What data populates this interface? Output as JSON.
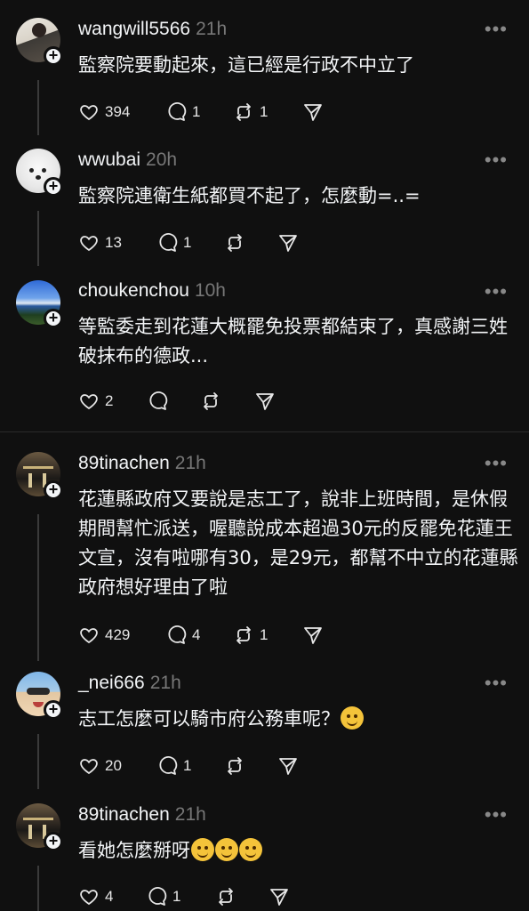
{
  "posts": [
    {
      "username": "wangwill5566",
      "time": "21h",
      "text": "監察院要動起來，這已經是行政不中立了",
      "likes": "394",
      "comments": "1",
      "reposts": "1"
    },
    {
      "username": "wwubai",
      "time": "20h",
      "text": "監察院連衛生紙都買不起了，怎麼動=..=",
      "likes": "13",
      "comments": "1",
      "reposts": ""
    },
    {
      "username": "choukenchou",
      "time": "10h",
      "text": "等監委走到花蓮大概罷免投票都結束了，真感謝三姓破抹布的德政...",
      "likes": "2",
      "comments": "",
      "reposts": ""
    },
    {
      "username": "89tinachen",
      "time": "21h",
      "text": "花蓮縣政府又要說是志工了，說非上班時間，是休假期間幫忙派送，喔聽說成本超過30元的反罷免花蓮王文宣，沒有啦哪有30，是29元，都幫不中立的花蓮縣政府想好理由了啦",
      "likes": "429",
      "comments": "4",
      "reposts": "1"
    },
    {
      "username": "_nei666",
      "time": "21h",
      "text": "志工怎麼可以騎市府公務車呢？",
      "likes": "20",
      "comments": "1",
      "reposts": ""
    },
    {
      "username": "89tinachen",
      "time": "21h",
      "text": "看她怎麼掰呀",
      "likes": "4",
      "comments": "1",
      "reposts": ""
    }
  ],
  "more_label": "•••",
  "icons": {
    "like": "heart-icon",
    "comment": "comment-bubble-icon",
    "repost": "repost-icon",
    "share": "send-icon",
    "follow": "plus-icon"
  }
}
